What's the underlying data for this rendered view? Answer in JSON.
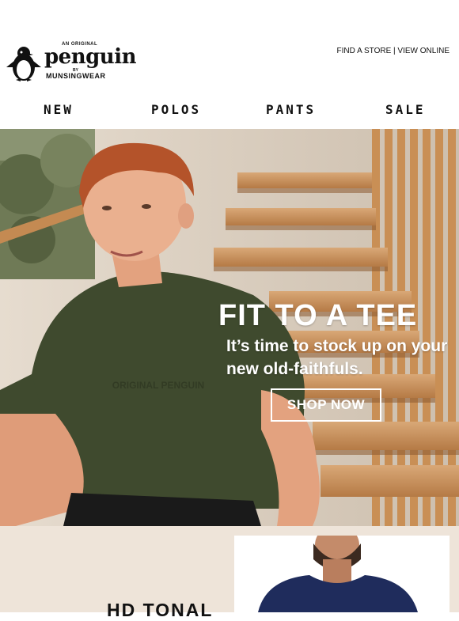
{
  "header": {
    "logo_tagline": "AN ORIGINAL",
    "logo_word": "penguin",
    "logo_by": "BY",
    "logo_sub": "MUNSINGWEAR",
    "find_store": "FIND A STORE",
    "separator": " | ",
    "view_online": "VIEW ONLINE"
  },
  "nav": {
    "items": [
      {
        "label": "NEW"
      },
      {
        "label": "POLOS"
      },
      {
        "label": "PANTS"
      },
      {
        "label": "SALE"
      }
    ]
  },
  "hero": {
    "title": "FIT TO A TEE",
    "subtitle": "It’s time to stock up on your new old-faithfuls.",
    "cta": "SHOP NOW",
    "shirt_print": "ORIGINAL PENGUIN"
  },
  "lower": {
    "title": "HD TONAL"
  },
  "colors": {
    "brand_text": "#111111",
    "shirt": "#3f4a2e",
    "lower_bg": "#eee4d9",
    "product_shirt": "#1f2c5c"
  }
}
